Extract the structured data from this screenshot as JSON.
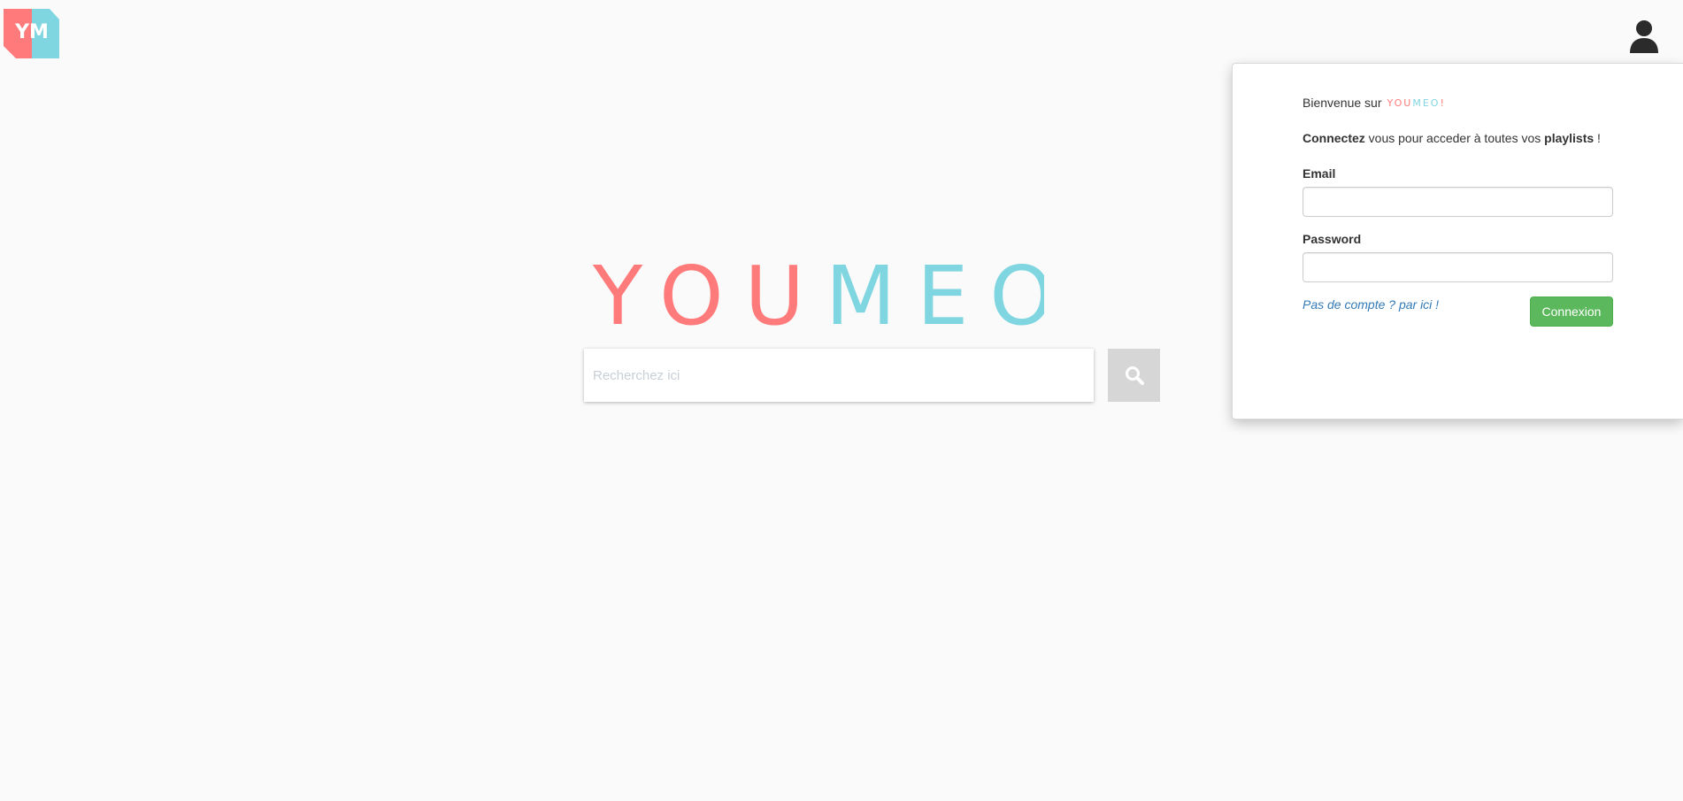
{
  "app": {
    "logo_letters": "YM",
    "wordmark_pink": "YOU",
    "wordmark_cyan": "MEO",
    "wordmark_mark": "!"
  },
  "colors": {
    "brand_pink": "#ff7b7b",
    "brand_cyan": "#7fd5e0",
    "success_green": "#5cb85c",
    "link_blue": "#337ab7"
  },
  "search": {
    "placeholder": "Recherchez ici",
    "button_icon": "search-icon"
  },
  "header": {
    "user_icon": "user-icon"
  },
  "login": {
    "welcome_text": "Bienvenue sur",
    "welcome_brand_pink": "YOU",
    "welcome_brand_cyan": "MEO",
    "welcome_brand_mark": "!",
    "intro_strong_1": "Connectez",
    "intro_middle": " vous pour acceder à toutes vos ",
    "intro_strong_2": "playlists",
    "intro_end": " !",
    "email_label": "Email",
    "email_value": "",
    "password_label": "Password",
    "password_value": "",
    "signup_link": "Pas de compte ? par ici !",
    "submit_label": "Connexion"
  }
}
